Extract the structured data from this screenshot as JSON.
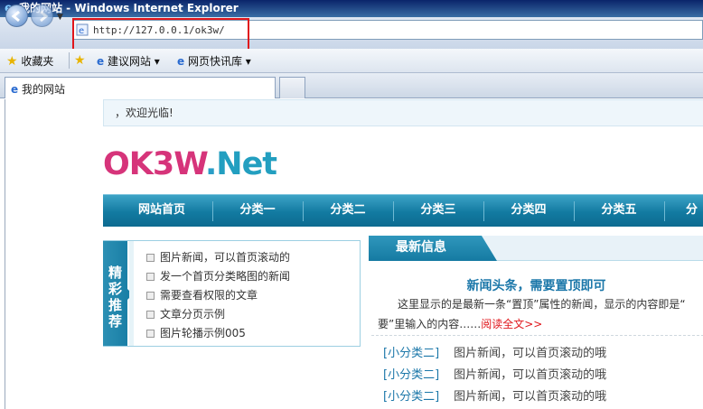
{
  "window": {
    "title": "我的网站 - Windows Internet Explorer"
  },
  "address": {
    "url": "http://127.0.0.1/ok3w/"
  },
  "favorites": {
    "label": "收藏夹",
    "items": [
      "建议网站",
      "网页快讯库"
    ]
  },
  "tabs": [
    {
      "label": "我的网站"
    }
  ],
  "page": {
    "welcome": "，欢迎光临!",
    "logo": {
      "part1": "OK3W",
      "dot": ".",
      "part2": "Net"
    },
    "nav": [
      "网站首页",
      "分类一",
      "分类二",
      "分类三",
      "分类四",
      "分类五",
      "分类"
    ],
    "recommend": {
      "title": "精彩推荐",
      "items": [
        "图片新闻，可以首页滚动的",
        "发一个首页分类略图的新闻",
        "需要查看权限的文章",
        "文章分页示例",
        "图片轮播示例005"
      ]
    },
    "news": {
      "tab": "最新信息",
      "headline": "新闻头条，需要置顶即可",
      "desc_line1": "这里显示的是最新一条“置顶”属性的新闻，显示的内容即是“",
      "desc_line2": "要”里输入的内容……",
      "read_more": "阅读全文>>",
      "items": [
        {
          "category": "[小分类二]",
          "title": "图片新闻，可以首页滚动的哦"
        },
        {
          "category": "[小分类二]",
          "title": "图片新闻，可以首页滚动的哦"
        },
        {
          "category": "[小分类二]",
          "title": "图片新闻，可以首页滚动的哦"
        }
      ]
    }
  }
}
